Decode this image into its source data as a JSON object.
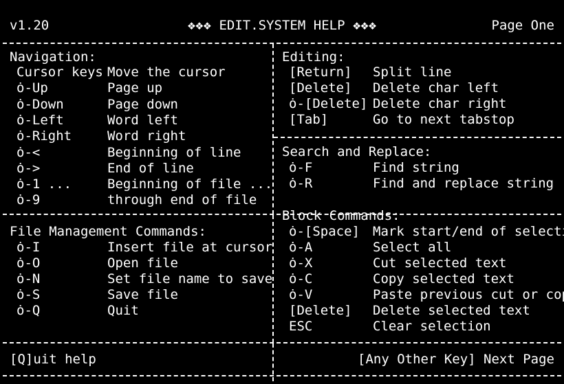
{
  "header": {
    "version": "v1.20",
    "title_left_deco": "❖❖❖",
    "title": "EDIT.SYSTEM HELP",
    "title_right_deco": "❖❖❖",
    "page": "Page One"
  },
  "navigation": {
    "heading": "Navigation:",
    "rows": [
      {
        "key": "Cursor keys",
        "desc": "Move the cursor"
      },
      {
        "key": "ȯ-Up",
        "desc": "Page up"
      },
      {
        "key": "ȯ-Down",
        "desc": "Page down"
      },
      {
        "key": "ȯ-Left",
        "desc": "Word left"
      },
      {
        "key": "ȯ-Right",
        "desc": "Word right"
      },
      {
        "key": "ȯ-<",
        "desc": "Beginning of line"
      },
      {
        "key": "ȯ->",
        "desc": "End of line"
      },
      {
        "key": "ȯ-1 ...",
        "desc": "Beginning of file ..."
      },
      {
        "key": "ȯ-9",
        "desc": "through end of file"
      }
    ]
  },
  "editing": {
    "heading": "Editing:",
    "rows": [
      {
        "key": "[Return]",
        "desc": "Split line"
      },
      {
        "key": "[Delete]",
        "desc": "Delete char left"
      },
      {
        "key": "ȯ-[Delete]",
        "desc": "Delete char right"
      },
      {
        "key": "[Tab]",
        "desc": "Go to next tabstop"
      }
    ]
  },
  "search": {
    "heading": "Search and Replace:",
    "rows": [
      {
        "key": "ȯ-F",
        "desc": "Find string"
      },
      {
        "key": "ȯ-R",
        "desc": "Find and replace string"
      }
    ]
  },
  "file": {
    "heading": "File Management Commands:",
    "rows": [
      {
        "key": "ȯ-I",
        "desc": "Insert file at cursor"
      },
      {
        "key": "ȯ-O",
        "desc": "Open file"
      },
      {
        "key": "ȯ-N",
        "desc": "Set file name to save"
      },
      {
        "key": "ȯ-S",
        "desc": "Save file"
      },
      {
        "key": "ȯ-Q",
        "desc": "Quit"
      }
    ]
  },
  "block": {
    "heading": "Block Commands:",
    "rows": [
      {
        "key": "ȯ-[Space]",
        "desc": "Mark start/end of selection"
      },
      {
        "key": "ȯ-A",
        "desc": "Select all"
      },
      {
        "key": "ȯ-X",
        "desc": "Cut selected text"
      },
      {
        "key": "ȯ-C",
        "desc": "Copy selected text"
      },
      {
        "key": "ȯ-V",
        "desc": "Paste previous cut or copy"
      },
      {
        "key": "[Delete]",
        "desc": "Delete selected text"
      },
      {
        "key": "ESC",
        "desc": "Clear selection"
      }
    ]
  },
  "footer": {
    "quit": "[Q]uit help",
    "next": "[Any Other Key] Next Page"
  }
}
